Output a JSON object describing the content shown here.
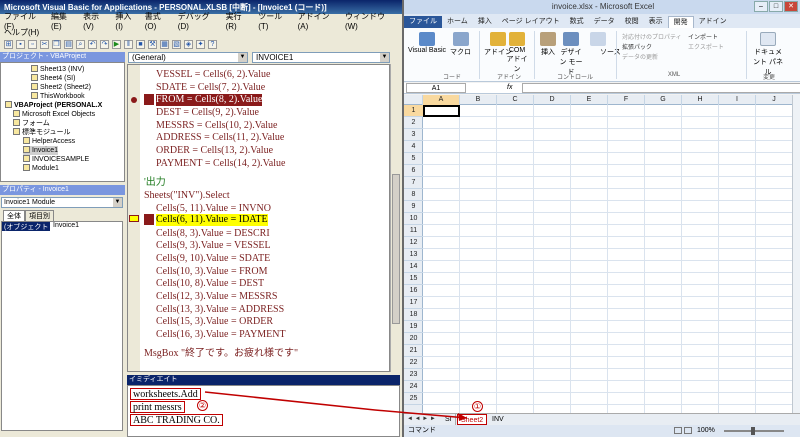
{
  "vbe": {
    "title": "Microsoft Visual Basic for Applications - PERSONAL.XLSB [中断] - [Invoice1 (コード)]",
    "menu": [
      "ファイル(F)",
      "編集(E)",
      "表示(V)",
      "挿入(I)",
      "書式(O)",
      "デバッグ(D)",
      "実行(R)",
      "ツール(T)",
      "アドイン(A)",
      "ウィンドウ(W)"
    ],
    "help": "ヘルプ(H)",
    "project_pane_title": "プロジェクト - VBAProject",
    "tree": [
      "Sheet13 (INV)",
      "Sheet4 (SI)",
      "Sheet2 (Sheet2)",
      "ThisWorkbook",
      "VBAProject (PERSONAL.X",
      "Microsoft Excel Objects",
      "フォーム",
      "標準モジュール",
      "HelperAccess",
      "Invoice1",
      "INVOICESAMPLE",
      "Module1"
    ],
    "properties_pane_title": "プロパティ - Invoice1",
    "properties_select": "Invoice1 Module",
    "properties_tabs": [
      "全体",
      "項目別"
    ],
    "property_key": "(オブジェクト名)",
    "property_value": "Invoice1",
    "object_select": "(General)",
    "proc_select": "INVOICE1",
    "code_lines": [
      "VESSEL = Cells(6, 2).Value",
      "SDATE = Cells(7, 2).Value",
      "FROM = Cells(8, 2).Value",
      "DEST = Cells(9, 2).Value",
      "MESSRS = Cells(10, 2).Value",
      "ADDRESS = Cells(11, 2).Value",
      "ORDER = Cells(13, 2).Value",
      "PAYMENT = Cells(14, 2).Value",
      "'出力",
      "Sheets(\"INV\").Select",
      "Cells(5, 11).Value = INVNO",
      "Cells(6, 11).Value = IDATE",
      "Cells(8, 3).Value = DESCRI",
      "Cells(9, 3).Value = VESSEL",
      "Cells(9, 10).Value = SDATE",
      "Cells(10, 3).Value = FROM",
      "Cells(10, 8).Value = DEST",
      "Cells(12, 3).Value = MESSRS",
      "Cells(13, 3).Value = ADDRESS",
      "Cells(15, 3).Value = ORDER",
      "Cells(16, 3).Value = PAYMENT",
      "MsgBox \"終了です。お疲れ様です\""
    ],
    "immediate_title": "イミディエイト",
    "immediate_lines": [
      "worksheets.Add",
      "print messrs",
      "ABC TRADING CO."
    ],
    "annotation_2": "②"
  },
  "excel": {
    "title": "invoice.xlsx - Microsoft Excel",
    "tabs": [
      "ファイル",
      "ホーム",
      "挿入",
      "ページ レイアウト",
      "数式",
      "データ",
      "校閲",
      "表示",
      "開発",
      "アドイン"
    ],
    "ribbon": {
      "visual_basic": "Visual Basic",
      "macro": "マクロ",
      "addin": "アドイン",
      "com_addin": "COM アドイン",
      "insert": "挿入",
      "design_mode": "デザイン モード",
      "source": "ソース",
      "properties": "プロパティ",
      "view_code": "コードの表示",
      "run_dialog": "ダイアログの実行",
      "xml_map_props": "対応付けのプロパティ",
      "expansion_pack": "拡張パック",
      "refresh_data": "データの更新",
      "import": "インポート",
      "export": "エクスポート",
      "doc_panel": "ドキュメント パネル",
      "group_code": "コード",
      "group_addin": "アドイン",
      "group_control": "コントロール",
      "group_xml": "XML",
      "group_modify": "変更"
    },
    "name_box": "A1",
    "fx": "fx",
    "columns": [
      "A",
      "B",
      "C",
      "D",
      "E",
      "F",
      "G",
      "H",
      "I",
      "J"
    ],
    "rows": [
      "1",
      "2",
      "3",
      "4",
      "5",
      "6",
      "7",
      "8",
      "9",
      "10",
      "11",
      "12",
      "13",
      "14",
      "15",
      "16",
      "17",
      "18",
      "19",
      "20",
      "21",
      "22",
      "23",
      "24",
      "25"
    ],
    "sheet_nav": "◄ ◄ ► ►",
    "sheets": [
      "SI",
      "Sheet2",
      "INV"
    ],
    "status": "コマンド",
    "zoom": "100%",
    "annotation_1": "①"
  },
  "colors": {
    "breakpoint": "#8a1a1a",
    "exec_highlight": "#ffff00",
    "annotation": "#c00000",
    "excel_file_tab": "#2a5699"
  }
}
